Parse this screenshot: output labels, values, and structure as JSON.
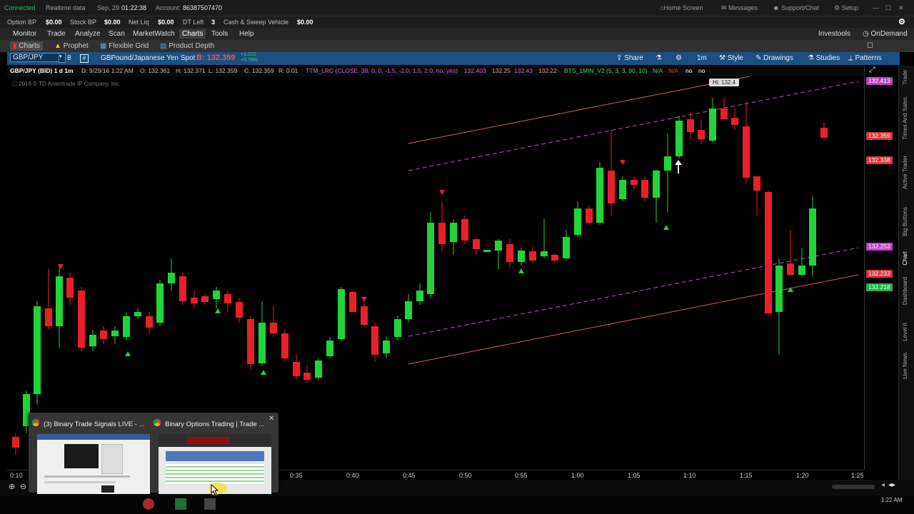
{
  "status": {
    "connection": "Connected",
    "data_mode": "Realtime data",
    "date": "Sep, 29",
    "time": "01:22:38",
    "account_label": "Account:",
    "account": "86387507470",
    "home_screen": "Home Screen",
    "messages": "Messages",
    "support": "Support/Chat",
    "setup": "Setup"
  },
  "account_bar": {
    "option_bp_label": "Option BP",
    "option_bp": "$0.00",
    "stock_bp_label": "Stock BP",
    "stock_bp": "$0.00",
    "net_liq_label": "Net Liq",
    "net_liq": "$0.00",
    "dt_left_label": "DT Left",
    "dt_left": "3",
    "cash_label": "Cash & Sweep Vehicle",
    "cash": "$0.00"
  },
  "menu": {
    "items": [
      "Monitor",
      "Trade",
      "Analyze",
      "Scan",
      "MarketWatch",
      "Charts",
      "Tools",
      "Help"
    ],
    "investools": "Investools",
    "ondemand": "OnDemand"
  },
  "subtabs": {
    "charts": "Charts",
    "prophet": "Prophet",
    "flexible_grid": "Flexible Grid",
    "product_depth": "Product Depth"
  },
  "toolbar": {
    "symbol": "GBP/JPY",
    "description": "GBPound/Japanese Yen Spot",
    "bid": "B: 132.359",
    "change": "+1.022",
    "change_pct": "+0.78%",
    "share": "Share",
    "interval": "1m",
    "style": "Style",
    "drawings": "Drawings",
    "studies": "Studies",
    "patterns": "Patterns"
  },
  "studybar": {
    "sym": "GBP/JPY (BID) 1 d 1m",
    "date": "D: 9/29/16 1:22 AM",
    "open": "O: 132.361",
    "high": "H: 132.371",
    "low": "L: 132.359",
    "close": "C: 132.359",
    "range": "R: 0.01",
    "study1": "TTM_LRC (CLOSE, 38, 0, 0, -1.5, -2.0, 1.5, 2.0, no, yes)",
    "s1v1": "132.403",
    "s1v2": "132.25",
    "s1v3": "132.43",
    "s1v4": "132.22",
    "study2": "BTS_1MIN_V2 (5, 3, 3, 90, 10)",
    "na1": "N/A",
    "na2": "N/A",
    "no1": "no",
    "no2": "no"
  },
  "chart": {
    "copyright": "2016 © TD Ameritrade IP Company, Inc.",
    "high_label": "Hi: 132.4"
  },
  "price_labels": [
    "132.413",
    "132.359",
    "132.338",
    "132.253",
    "132.233",
    "132.218"
  ],
  "time_labels": [
    "0:10",
    "0:35",
    "0:40",
    "0:45",
    "0:50",
    "0:55",
    "1:00",
    "1:05",
    "1:10",
    "1:15",
    "1:20",
    "1:25"
  ],
  "right_tabs": [
    "Trade",
    "Times And Sales",
    "Active Trader",
    "Big Buttons",
    "Chart",
    "Dashboard",
    "Level II",
    "Live News"
  ],
  "popup": {
    "tab1": "(3) Binary Trade Signals LIVE - ...",
    "tab2": "Binary Options Trading | Trade ..."
  },
  "clock": "1:22 AM"
}
